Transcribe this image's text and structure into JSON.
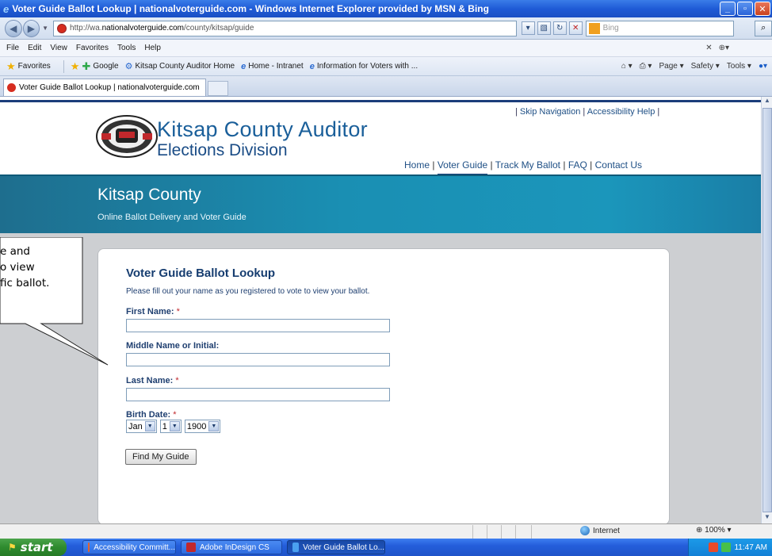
{
  "window": {
    "title": "Voter Guide Ballot Lookup | nationalvoterguide.com - Windows Internet Explorer provided by MSN & Bing",
    "minimize": "_",
    "maximize": "▫",
    "close": "✕"
  },
  "address_bar": {
    "url_prefix": "http://wa.",
    "url_domain": "nationalvoterguide.com",
    "url_path": "/county/kitsap/guide",
    "search_placeholder": "Bing"
  },
  "menu": [
    "File",
    "Edit",
    "View",
    "Favorites",
    "Tools",
    "Help"
  ],
  "favorites_bar": {
    "favorites_label": "Favorites",
    "links": [
      "Google",
      "Kitsap County Auditor Home",
      "Home - Intranet",
      "Information for Voters with ..."
    ],
    "commands": [
      "Page ▾",
      "Safety ▾",
      "Tools ▾"
    ]
  },
  "tab": {
    "label": "Voter Guide Ballot Lookup | nationalvoterguide.com"
  },
  "page": {
    "header_title": "Kitsap County Auditor",
    "header_subtitle": "Elections Division",
    "utility_links": [
      "Skip Navigation",
      "Accessibility Help"
    ],
    "nav": [
      "Home",
      "Voter Guide",
      "Track My Ballot",
      "FAQ",
      "Contact Us"
    ],
    "banner_title": "Kitsap County",
    "banner_subtitle": "Online Ballot Delivery and Voter Guide",
    "form": {
      "title": "Voter Guide Ballot Lookup",
      "description": "Please fill out your name as you registered to vote to view your ballot.",
      "first_name_label": "First Name:",
      "middle_name_label": "Middle Name or Initial:",
      "last_name_label": "Last Name:",
      "birth_date_label": "Birth Date:",
      "required_mark": "*",
      "birth_month": "Jan",
      "birth_day": "1",
      "birth_year": "1900",
      "submit_label": "Find My Guide"
    },
    "callout_lines": [
      "e and",
      "o view",
      "fic ballot."
    ]
  },
  "status_bar": {
    "zone": "Internet",
    "zoom": "100%"
  },
  "taskbar": {
    "start_label": "start",
    "tasks": [
      "Accessibility Committ...",
      "Adobe InDesign CS",
      "Voter Guide Ballot Lo..."
    ],
    "clock": "11:47 AM"
  },
  "colors": {
    "banner": "#1a8fb3",
    "heading_blue": "#163d70",
    "required_red": "#c0282c"
  }
}
